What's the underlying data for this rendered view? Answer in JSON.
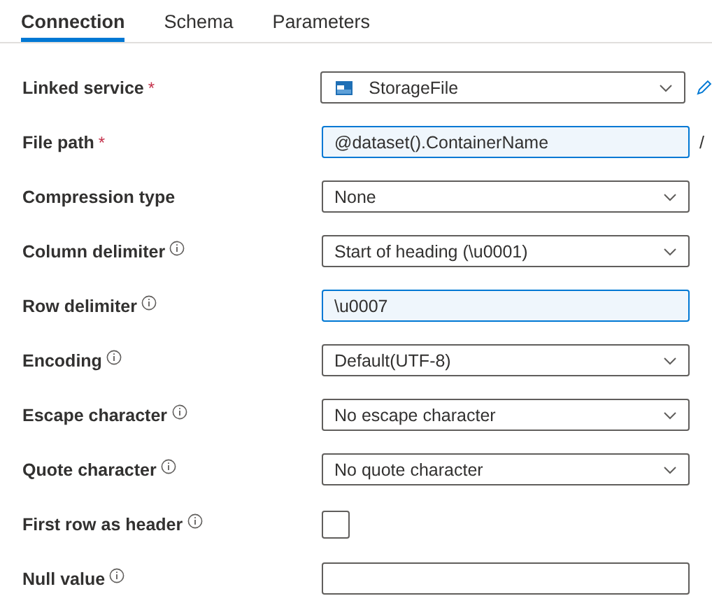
{
  "tabs": [
    {
      "label": "Connection",
      "selected": true
    },
    {
      "label": "Schema",
      "selected": false
    },
    {
      "label": "Parameters",
      "selected": false
    }
  ],
  "fields": [
    {
      "label": "Linked service",
      "marker": "*",
      "info": false,
      "kind": "service-dropdown",
      "value": "StorageFile"
    },
    {
      "label": "File path",
      "marker": "*",
      "info": false,
      "kind": "expression",
      "value": "@dataset().ContainerName",
      "suffix": "/"
    },
    {
      "label": "Compression type",
      "info": false,
      "kind": "dropdown",
      "value": "None"
    },
    {
      "label": "Column delimiter",
      "info": true,
      "kind": "dropdown",
      "value": "Start of heading (\\u0001)"
    },
    {
      "label": "Row delimiter",
      "info": true,
      "kind": "expression",
      "value": "\\u0007"
    },
    {
      "label": "Encoding",
      "info": true,
      "kind": "dropdown",
      "value": "Default(UTF-8)"
    },
    {
      "label": "Escape character",
      "info": true,
      "kind": "dropdown",
      "value": "No escape character"
    },
    {
      "label": "Quote character",
      "info": true,
      "kind": "dropdown",
      "value": "No quote character"
    },
    {
      "label": "First row as header",
      "info": true,
      "kind": "checkbox",
      "checked": false
    },
    {
      "label": "Null value",
      "info": true,
      "kind": "text"
    }
  ]
}
